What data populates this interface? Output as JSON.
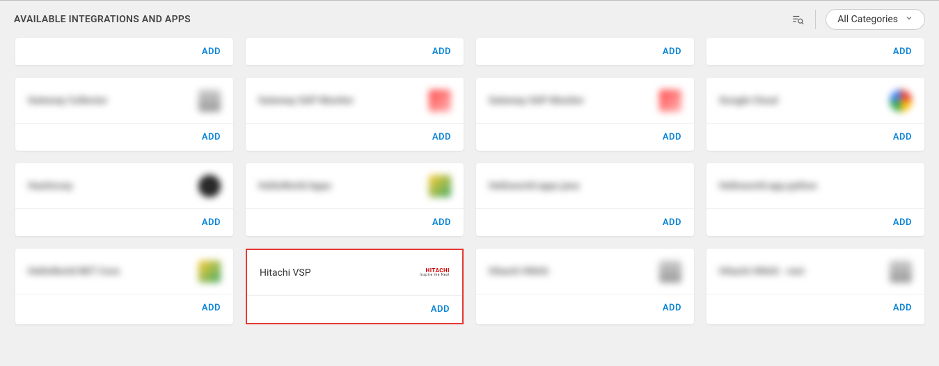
{
  "header": {
    "title": "AVAILABLE INTEGRATIONS AND APPS",
    "categories_label": "All Categories"
  },
  "add_label": "ADD",
  "rows": [
    {
      "partial": true,
      "cards": [
        {
          "blurred": true
        },
        {
          "blurred": true
        },
        {
          "blurred": true
        },
        {
          "blurred": true
        }
      ]
    },
    {
      "cards": [
        {
          "name": "Gateway Collector",
          "blurred": true,
          "logo": "swatch-grey"
        },
        {
          "name": "Gateway SAP Monitor",
          "blurred": true,
          "logo": "swatch-red"
        },
        {
          "name": "Gateway SAP Monitor",
          "blurred": true,
          "logo": "swatch-red"
        },
        {
          "name": "Google Cloud",
          "blurred": true,
          "logo": "swatch-multi"
        }
      ]
    },
    {
      "cards": [
        {
          "name": "Hashicorp",
          "blurred": true,
          "logo": "swatch-dark"
        },
        {
          "name": "HelloWorld Apps",
          "blurred": true,
          "logo": "swatch-yellow"
        },
        {
          "name": "Helloworld apps java",
          "blurred": true,
          "logo": ""
        },
        {
          "name": "Helloworld app python",
          "blurred": true,
          "logo": ""
        }
      ]
    },
    {
      "cards": [
        {
          "name": "HelloWorld NET Core",
          "blurred": true,
          "logo": "swatch-yellow"
        },
        {
          "name": "Hitachi VSP",
          "blurred": false,
          "highlighted": true,
          "logo": "hitachi"
        },
        {
          "name": "Hitachi HNAS",
          "blurred": true,
          "logo": "swatch-grey"
        },
        {
          "name": "Hitachi HNAS - rest",
          "blurred": true,
          "logo": "swatch-grey"
        }
      ]
    }
  ]
}
